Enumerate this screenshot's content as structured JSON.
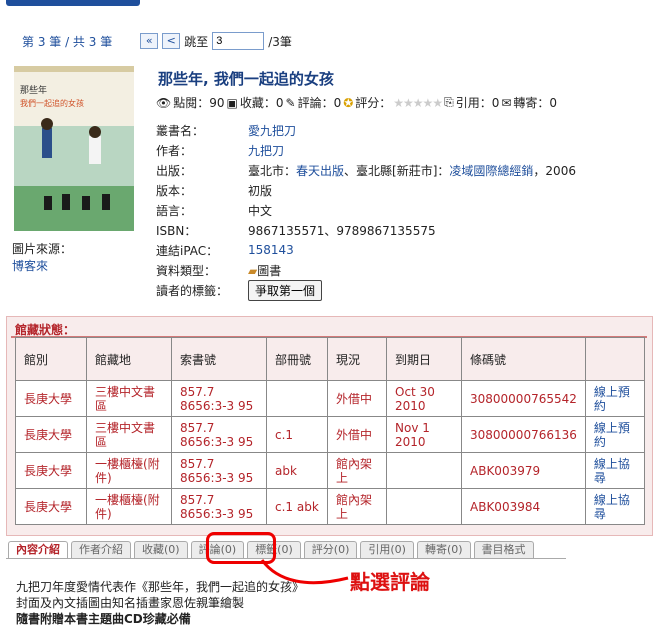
{
  "pager": {
    "status": "第 3 筆 / 共 3 筆",
    "first": "«",
    "prev": "<",
    "jump_label": "跳至",
    "page_value": "3",
    "total": "/3筆"
  },
  "book": {
    "title": "那些年, 我們一起追的女孩",
    "image_source_label": "圖片來源：",
    "image_source_link": "博客來",
    "cover_text_1": "那些年",
    "cover_text_2": "我們一起追的女孩"
  },
  "stats": {
    "views": "點閱：90",
    "favorites": "收藏：0",
    "comments": "評論：0",
    "rating": "評分：",
    "citations": "引用：0",
    "forwards": "轉寄：0"
  },
  "meta": [
    {
      "key": "叢書名：",
      "value": "愛九把刀",
      "link": true
    },
    {
      "key": "作者：",
      "value": "九把刀",
      "link": true
    },
    {
      "key": "版本：",
      "value": "初版",
      "link": false
    },
    {
      "key": "語言：",
      "value": "中文",
      "link": false
    },
    {
      "key": "ISBN：",
      "value": "9867135571、9789867135575",
      "link": false
    },
    {
      "key": "連結iPAC：",
      "value": "158143",
      "link": true
    }
  ],
  "publish": {
    "key": "出版：",
    "place1": "臺北市：",
    "pub1": "春天出版",
    "sep": "、臺北縣[新莊市]：",
    "pub2": "凌域國際總經銷",
    "year": "，2006"
  },
  "type": {
    "key": "資料類型：",
    "value": "圖書"
  },
  "tags": {
    "key": "讀者的標籤：",
    "button": "爭取第一個"
  },
  "holdings": {
    "header": "館藏狀態：",
    "columns": [
      "館別",
      "館藏地",
      "索書號",
      "部冊號",
      "現況",
      "到期日",
      "條碼號",
      ""
    ],
    "rows": [
      [
        "長庚大學",
        "三樓中文書區",
        "857.7 8656:3-3 95",
        "",
        "外借中",
        "Oct 30 2010",
        "30800000765542",
        "線上預約"
      ],
      [
        "長庚大學",
        "三樓中文書區",
        "857.7 8656:3-3 95",
        "c.1",
        "外借中",
        "Nov 1 2010",
        "30800000766136",
        "線上預約"
      ],
      [
        "長庚大學",
        "一樓櫃檯(附件)",
        "857.7 8656:3-3 95",
        "abk",
        "館內架上",
        "",
        "ABK003979",
        "線上協尋"
      ],
      [
        "長庚大學",
        "一樓櫃檯(附件)",
        "857.7 8656:3-3 95",
        "c.1 abk",
        "館內架上",
        "",
        "ABK003984",
        "線上協尋"
      ]
    ]
  },
  "tabs": [
    "內容介紹",
    "作者介紹",
    "收藏(0)",
    "評論(0)",
    "標籤(0)",
    "評分(0)",
    "引用(0)",
    "轉寄(0)",
    "書目格式"
  ],
  "content_lines": [
    "九把刀年度愛情代表作《那些年，我們一起追的女孩》",
    "封面及內文插圖由知名插畫家恩佐親筆繪製",
    "隨書附贈本書主題曲CD珍藏必備"
  ],
  "annotation": "點選評論",
  "colors": {
    "link": "#1f4f9c",
    "accent_red": "#b4242a",
    "highlight": "#e00000"
  }
}
